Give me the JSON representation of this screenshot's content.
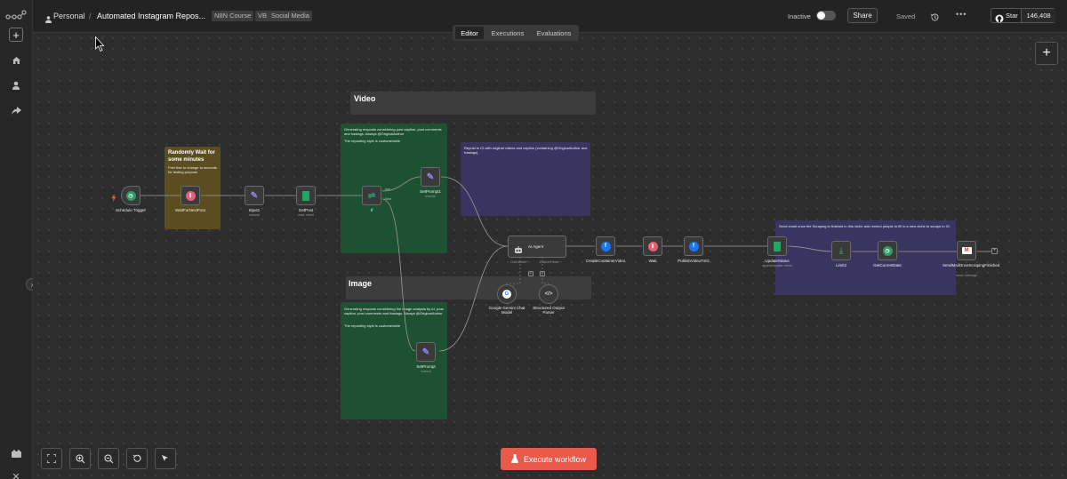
{
  "header": {
    "project": "Personal",
    "separator": "/",
    "workflow_name": "Automated Instagram Repos...",
    "tags": [
      "N8N Course",
      "VB",
      "Social Media"
    ],
    "status_label": "Inactive",
    "share_label": "Share",
    "saved_label": "Saved",
    "star_label": "Star",
    "star_count": "146,408"
  },
  "tabs": [
    {
      "label": "Editor",
      "active": true
    },
    {
      "label": "Executions",
      "active": false
    },
    {
      "label": "Evaluations",
      "active": false
    }
  ],
  "sticky_notes": {
    "video_title": "Video",
    "image_title": "Image",
    "wait_title": "Randomly Wait for some minutes",
    "wait_text": "Feel free to change to seconds for testing purpose",
    "video_prompt_text": "Generating resposts considering post caption, post comments and hastags. Always @OriginalAuthor",
    "video_prompt_text2": "The reposting style is customerable",
    "repost_text": "Repost to IG with original videos and caption (containing @OriginalAuthor and hastags)",
    "image_prompt_text": "Generating resposts considering the image analysis by AI, post caption, post comments and hastags. Always @OriginalAuthor",
    "image_prompt_text2": "The reposting style is customerable",
    "email_text": "Send email once the Scraping is finished in this niche and remind people to fill in a new niche to scrape in IG."
  },
  "nodes": {
    "schedule": {
      "label": "Schedule Trigger",
      "icon": "clock-icon"
    },
    "wait_next": {
      "label": "WaitForNextPost",
      "icon": "pause-icon"
    },
    "input1": {
      "label": "Input1",
      "sub": "manual",
      "icon": "pencil-icon"
    },
    "getpost": {
      "label": "GetPost",
      "sub": "read: sheet",
      "icon": "sheets-icon"
    },
    "if": {
      "label": "If",
      "true_label": "true",
      "false_label": "false",
      "icon": "branch-icon"
    },
    "setprompt1": {
      "label": "SetPrompt1",
      "sub": "manual",
      "icon": "pencil-icon"
    },
    "setprompt": {
      "label": "SetPrompt",
      "sub": "manual",
      "icon": "pencil-icon"
    },
    "agent": {
      "label": "AI Agent",
      "chat_model": "Chat Model*",
      "output_parser": "Output Parser",
      "icon": "robot-icon"
    },
    "gemini": {
      "label": "Google Gemini Chat Model",
      "icon": "google-icon"
    },
    "parser": {
      "label": "Structured Output Parser",
      "icon": "code-icon"
    },
    "container": {
      "label": "CreateContainerVideo",
      "icon": "facebook-icon"
    },
    "wait": {
      "label": "Wait",
      "icon": "pause-icon"
    },
    "publish": {
      "label": "PublishVideoToIG",
      "icon": "facebook-icon"
    },
    "update": {
      "label": "UpdateStatus",
      "sub": "append/update: sheet",
      "icon": "sheets-icon"
    },
    "limit": {
      "label": "Limit2",
      "icon": "limit-icon"
    },
    "date": {
      "label": "GetCurrentDate",
      "icon": "clock-icon"
    },
    "mail": {
      "label": "SendMailOnceScrapingFinished",
      "sub": "send: message",
      "icon": "gmail-icon"
    }
  },
  "execute_label": "Execute workflow",
  "colors": {
    "execute": "#ea5a4b",
    "sticky_gray": "#3d3d3d",
    "sticky_green": "#1e5132",
    "sticky_purple": "#3a3560",
    "sticky_yellow": "#5c4d20"
  }
}
